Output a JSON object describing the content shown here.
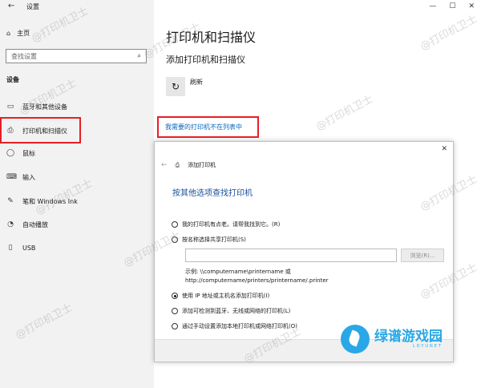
{
  "settings": {
    "window_title": "设置",
    "home": "主页",
    "search_placeholder": "查找设置",
    "section": "设备",
    "nav": [
      "蓝牙和其他设备",
      "打印机和扫描仪",
      "鼠标",
      "输入",
      "笔和 Windows Ink",
      "自动播放",
      "USB"
    ]
  },
  "main": {
    "title": "打印机和扫描仪",
    "subtitle": "添加打印机和扫描仪",
    "refresh": "刷新",
    "not_listed_link": "我需要的打印机不在列表中"
  },
  "dialog": {
    "header": "添加打印机",
    "title": "按其他选项查找打印机",
    "options": [
      "我的打印机有点老。请帮我找到它。(R)",
      "按名称选择共享打印机(S)",
      "使用 IP 地址或主机名添加打印机(I)",
      "添加可检测到蓝牙、无线或网络的打印机(L)",
      "通过手动设置添加本地打印机或网络打印机(O)"
    ],
    "selected_option": "使用 IP 地址或主机名添加打印机(I)",
    "browse": "浏览(R)...",
    "example_line1": "示例: \\\\computername\\printername 或",
    "example_line2": "http://computername/printers/printername/.printer"
  },
  "watermark": "@打印机卫士",
  "logo": {
    "text": "绿谱游戏园",
    "sub": "LDYUNET"
  }
}
